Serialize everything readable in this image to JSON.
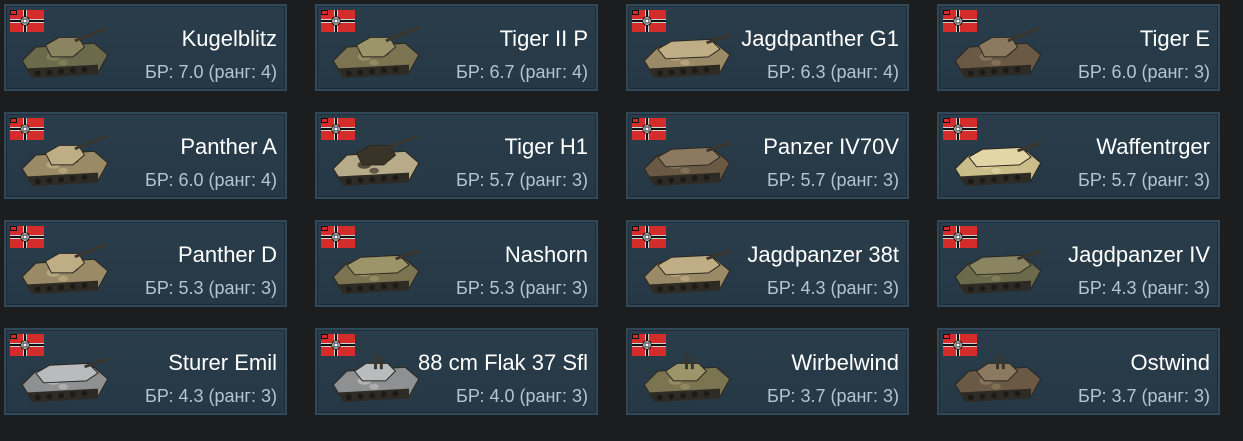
{
  "colors": {
    "page_background": "#1c1d1f",
    "card_background": "#2a3d4a",
    "card_border": "#30495a",
    "name_text": "#ffffff",
    "br_text": "#b5c4cf",
    "flag_red": "#d42b2b"
  },
  "vehicles": [
    {
      "name": "Kugelblitz",
      "br": "БР: 7.0 (ранг: 4)",
      "flag": "german-war-flag-icon",
      "icon": "tank-icon",
      "camo": "green"
    },
    {
      "name": "Tiger II P",
      "br": "БР: 6.7 (ранг: 4)",
      "flag": "german-war-flag-icon",
      "icon": "tank-icon",
      "camo": "olive"
    },
    {
      "name": "Jagdpanther G1",
      "br": "БР: 6.3 (ранг: 4)",
      "flag": "german-war-flag-icon",
      "icon": "tank-destroyer-icon",
      "camo": "sand"
    },
    {
      "name": "Tiger E",
      "br": "БР: 6.0 (ранг: 3)",
      "flag": "german-war-flag-icon",
      "icon": "tank-icon",
      "camo": "brown"
    },
    {
      "name": "Panther A",
      "br": "БР: 6.0 (ранг: 4)",
      "flag": "german-war-flag-icon",
      "icon": "tank-icon",
      "camo": "sand"
    },
    {
      "name": "Tiger H1",
      "br": "БР: 5.7 (ранг: 3)",
      "flag": "german-war-flag-icon",
      "icon": "tank-icon",
      "camo": "zebra"
    },
    {
      "name": "Panzer IV70V",
      "br": "БР: 5.7 (ранг: 3)",
      "flag": "german-war-flag-icon",
      "icon": "tank-destroyer-icon",
      "camo": "brown"
    },
    {
      "name": "Waffentrger",
      "br": "БР: 5.7 (ранг: 3)",
      "flag": "german-war-flag-icon",
      "icon": "tank-destroyer-icon",
      "camo": "yellow"
    },
    {
      "name": "Panther D",
      "br": "БР: 5.3 (ранг: 3)",
      "flag": "german-war-flag-icon",
      "icon": "tank-icon",
      "camo": "sand"
    },
    {
      "name": "Nashorn",
      "br": "БР: 5.3 (ранг: 3)",
      "flag": "german-war-flag-icon",
      "icon": "tank-destroyer-icon",
      "camo": "olive"
    },
    {
      "name": "Jagdpanzer 38t",
      "br": "БР: 4.3 (ранг: 3)",
      "flag": "german-war-flag-icon",
      "icon": "tank-destroyer-icon",
      "camo": "sand"
    },
    {
      "name": "Jagdpanzer IV",
      "br": "БР: 4.3 (ранг: 3)",
      "flag": "german-war-flag-icon",
      "icon": "tank-destroyer-icon",
      "camo": "green"
    },
    {
      "name": "Sturer Emil",
      "br": "БР: 4.3 (ранг: 3)",
      "flag": "german-war-flag-icon",
      "icon": "tank-destroyer-icon",
      "camo": "gray"
    },
    {
      "name": "88 cm Flak 37 Sfl",
      "br": "БР: 4.0 (ранг: 3)",
      "flag": "german-war-flag-icon",
      "icon": "spaa-icon",
      "camo": "gray"
    },
    {
      "name": "Wirbelwind",
      "br": "БР: 3.7 (ранг: 3)",
      "flag": "german-war-flag-icon",
      "icon": "spaa-icon",
      "camo": "olive"
    },
    {
      "name": "Ostwind",
      "br": "БР: 3.7 (ранг: 3)",
      "flag": "german-war-flag-icon",
      "icon": "spaa-icon",
      "camo": "brown"
    }
  ]
}
